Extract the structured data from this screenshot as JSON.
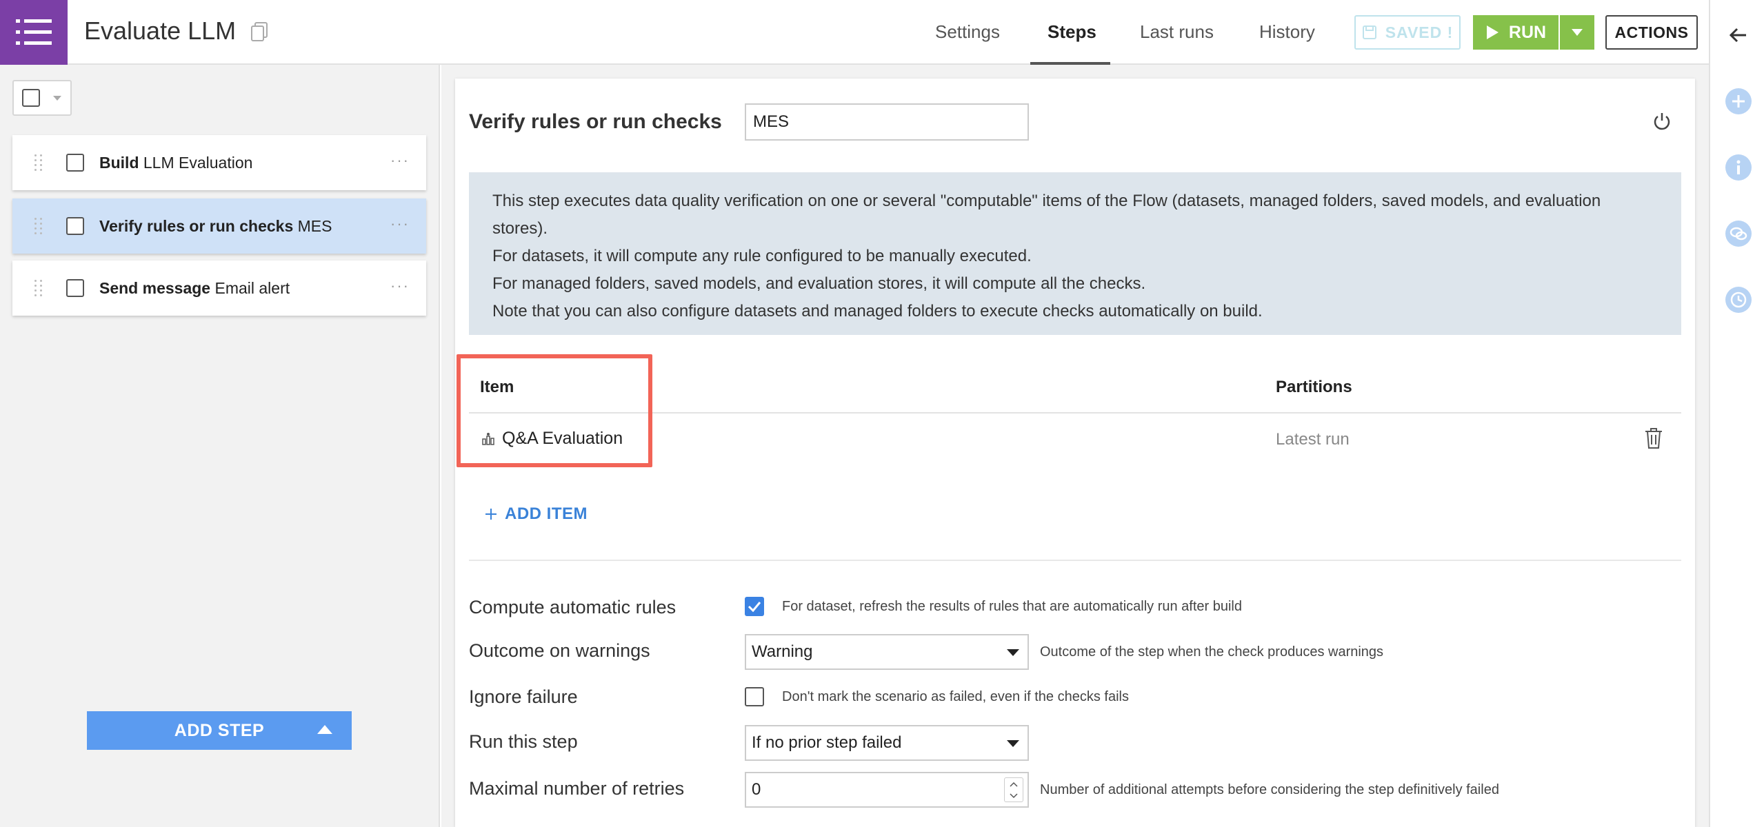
{
  "header": {
    "title": "Evaluate LLM",
    "tabs": [
      {
        "label": "Settings"
      },
      {
        "label": "Steps"
      },
      {
        "label": "Last runs"
      },
      {
        "label": "History"
      }
    ],
    "saved_label": "SAVED !",
    "run_label": "RUN",
    "actions_label": "ACTIONS"
  },
  "sidebar": {
    "steps": [
      {
        "type": "Build",
        "name": "LLM Evaluation"
      },
      {
        "type": "Verify rules or run checks",
        "name": "MES"
      },
      {
        "type": "Send message",
        "name": "Email alert"
      }
    ],
    "add_step_label": "ADD STEP"
  },
  "step": {
    "heading": "Verify rules or run checks",
    "name_value": "MES",
    "info_lines": [
      "This step executes data quality verification on one or several \"computable\" items of the Flow (datasets, managed folders, saved models, and evaluation stores).",
      "For datasets, it will compute any rule configured to be manually executed.",
      "For managed folders, saved models, and evaluation stores, it will compute all the checks.",
      "Note that you can also configure datasets and managed folders to execute checks automatically on build."
    ],
    "table": {
      "col_item": "Item",
      "col_partitions": "Partitions",
      "rows": [
        {
          "item": "Q&A Evaluation",
          "partitions": "Latest run"
        }
      ]
    },
    "add_item_label": "ADD ITEM"
  },
  "form": {
    "compute_rules": {
      "label": "Compute automatic rules",
      "checked": true,
      "hint": "For dataset, refresh the results of rules that are automatically run after build"
    },
    "outcome_warnings": {
      "label": "Outcome on warnings",
      "value": "Warning",
      "hint": "Outcome of the step when the check produces warnings"
    },
    "ignore_failure": {
      "label": "Ignore failure",
      "checked": false,
      "hint": "Don't mark the scenario as failed, even if the checks fails"
    },
    "run_step": {
      "label": "Run this step",
      "value": "If no prior step failed"
    },
    "max_retries": {
      "label": "Maximal number of retries",
      "value": "0",
      "hint": "Number of additional attempts before considering the step definitively failed"
    }
  },
  "colors": {
    "brand_purple": "#7b3fa6",
    "run_green": "#86c14a",
    "accent_blue": "#3a82e3",
    "highlight_red": "#f26457",
    "selected_step": "#cfe1f7"
  }
}
